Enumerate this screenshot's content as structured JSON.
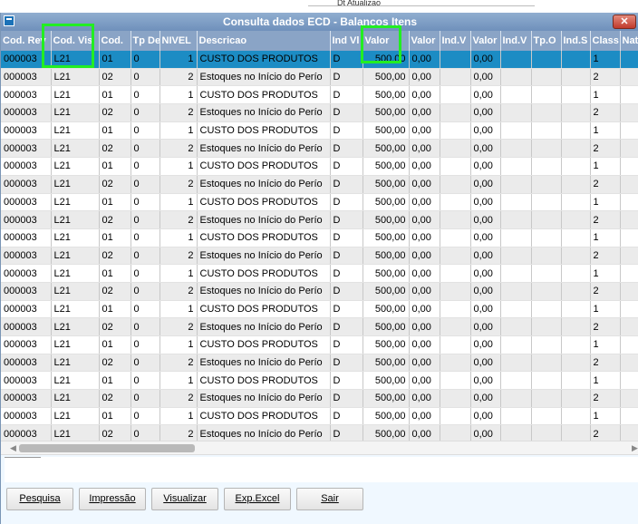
{
  "background_window": {
    "label": "Dt Atualizao"
  },
  "window": {
    "title": "Consulta dados ECD - Balanços Itens",
    "close_label": "✕"
  },
  "columns": [
    "Cod. Rev",
    "Cod. Vis",
    "Cod.",
    "Tp De",
    "NIVEL",
    "Descricao",
    "Ind Vl",
    "Valor",
    "Valor",
    "Ind.V",
    "Valor",
    "Ind.V",
    "Tp.O",
    "Ind.S",
    "Class",
    "Nat"
  ],
  "rows": [
    [
      "000003",
      "L21",
      "01",
      "0",
      "1",
      "CUSTO DOS PRODUTOS",
      "D",
      "500,00",
      "0,00",
      "",
      "0,00",
      "",
      "",
      "",
      "1",
      ""
    ],
    [
      "000003",
      "L21",
      "02",
      "0",
      "2",
      "Estoques no Início do Perío",
      "D",
      "500,00",
      "0,00",
      "",
      "0,00",
      "",
      "",
      "",
      "2",
      ""
    ],
    [
      "000003",
      "L21",
      "01",
      "0",
      "1",
      "CUSTO DOS PRODUTOS",
      "D",
      "500,00",
      "0,00",
      "",
      "0,00",
      "",
      "",
      "",
      "1",
      ""
    ],
    [
      "000003",
      "L21",
      "02",
      "0",
      "2",
      "Estoques no Início do Perío",
      "D",
      "500,00",
      "0,00",
      "",
      "0,00",
      "",
      "",
      "",
      "2",
      ""
    ],
    [
      "000003",
      "L21",
      "01",
      "0",
      "1",
      "CUSTO DOS PRODUTOS",
      "D",
      "500,00",
      "0,00",
      "",
      "0,00",
      "",
      "",
      "",
      "1",
      ""
    ],
    [
      "000003",
      "L21",
      "02",
      "0",
      "2",
      "Estoques no Início do Perío",
      "D",
      "500,00",
      "0,00",
      "",
      "0,00",
      "",
      "",
      "",
      "2",
      ""
    ],
    [
      "000003",
      "L21",
      "01",
      "0",
      "1",
      "CUSTO DOS PRODUTOS",
      "D",
      "500,00",
      "0,00",
      "",
      "0,00",
      "",
      "",
      "",
      "1",
      ""
    ],
    [
      "000003",
      "L21",
      "02",
      "0",
      "2",
      "Estoques no Início do Perío",
      "D",
      "500,00",
      "0,00",
      "",
      "0,00",
      "",
      "",
      "",
      "2",
      ""
    ],
    [
      "000003",
      "L21",
      "01",
      "0",
      "1",
      "CUSTO DOS PRODUTOS",
      "D",
      "500,00",
      "0,00",
      "",
      "0,00",
      "",
      "",
      "",
      "1",
      ""
    ],
    [
      "000003",
      "L21",
      "02",
      "0",
      "2",
      "Estoques no Início do Perío",
      "D",
      "500,00",
      "0,00",
      "",
      "0,00",
      "",
      "",
      "",
      "2",
      ""
    ],
    [
      "000003",
      "L21",
      "01",
      "0",
      "1",
      "CUSTO DOS PRODUTOS",
      "D",
      "500,00",
      "0,00",
      "",
      "0,00",
      "",
      "",
      "",
      "1",
      ""
    ],
    [
      "000003",
      "L21",
      "02",
      "0",
      "2",
      "Estoques no Início do Perío",
      "D",
      "500,00",
      "0,00",
      "",
      "0,00",
      "",
      "",
      "",
      "2",
      ""
    ],
    [
      "000003",
      "L21",
      "01",
      "0",
      "1",
      "CUSTO DOS PRODUTOS",
      "D",
      "500,00",
      "0,00",
      "",
      "0,00",
      "",
      "",
      "",
      "1",
      ""
    ],
    [
      "000003",
      "L21",
      "02",
      "0",
      "2",
      "Estoques no Início do Perío",
      "D",
      "500,00",
      "0,00",
      "",
      "0,00",
      "",
      "",
      "",
      "2",
      ""
    ],
    [
      "000003",
      "L21",
      "01",
      "0",
      "1",
      "CUSTO DOS PRODUTOS",
      "D",
      "500,00",
      "0,00",
      "",
      "0,00",
      "",
      "",
      "",
      "1",
      ""
    ],
    [
      "000003",
      "L21",
      "02",
      "0",
      "2",
      "Estoques no Início do Perío",
      "D",
      "500,00",
      "0,00",
      "",
      "0,00",
      "",
      "",
      "",
      "2",
      ""
    ],
    [
      "000003",
      "L21",
      "01",
      "0",
      "1",
      "CUSTO DOS PRODUTOS",
      "D",
      "500,00",
      "0,00",
      "",
      "0,00",
      "",
      "",
      "",
      "1",
      ""
    ],
    [
      "000003",
      "L21",
      "02",
      "0",
      "2",
      "Estoques no Início do Perío",
      "D",
      "500,00",
      "0,00",
      "",
      "0,00",
      "",
      "",
      "",
      "2",
      ""
    ],
    [
      "000003",
      "L21",
      "01",
      "0",
      "1",
      "CUSTO DOS PRODUTOS",
      "D",
      "500,00",
      "0,00",
      "",
      "0,00",
      "",
      "",
      "",
      "1",
      ""
    ],
    [
      "000003",
      "L21",
      "02",
      "0",
      "2",
      "Estoques no Início do Perío",
      "D",
      "500,00",
      "0,00",
      "",
      "0,00",
      "",
      "",
      "",
      "2",
      ""
    ],
    [
      "000003",
      "L21",
      "01",
      "0",
      "1",
      "CUSTO DOS PRODUTOS",
      "D",
      "500,00",
      "0,00",
      "",
      "0,00",
      "",
      "",
      "",
      "1",
      ""
    ],
    [
      "000003",
      "L21",
      "02",
      "0",
      "2",
      "Estoques no Início do Perío",
      "D",
      "500,00",
      "0,00",
      "",
      "0,00",
      "",
      "",
      "",
      "2",
      ""
    ]
  ],
  "selected_row": 0,
  "buttons": {
    "pesquisa": "Pesquisa",
    "impressao": "Impressão",
    "visualizar": "Visualizar",
    "exp_excel": "Exp.Excel",
    "sair": "Sair"
  },
  "colors": {
    "title_bar": "#7e9dc6",
    "header": "#8aa4c6",
    "selected_row": "#1c8cc4",
    "highlight_box": "#22ee22"
  }
}
